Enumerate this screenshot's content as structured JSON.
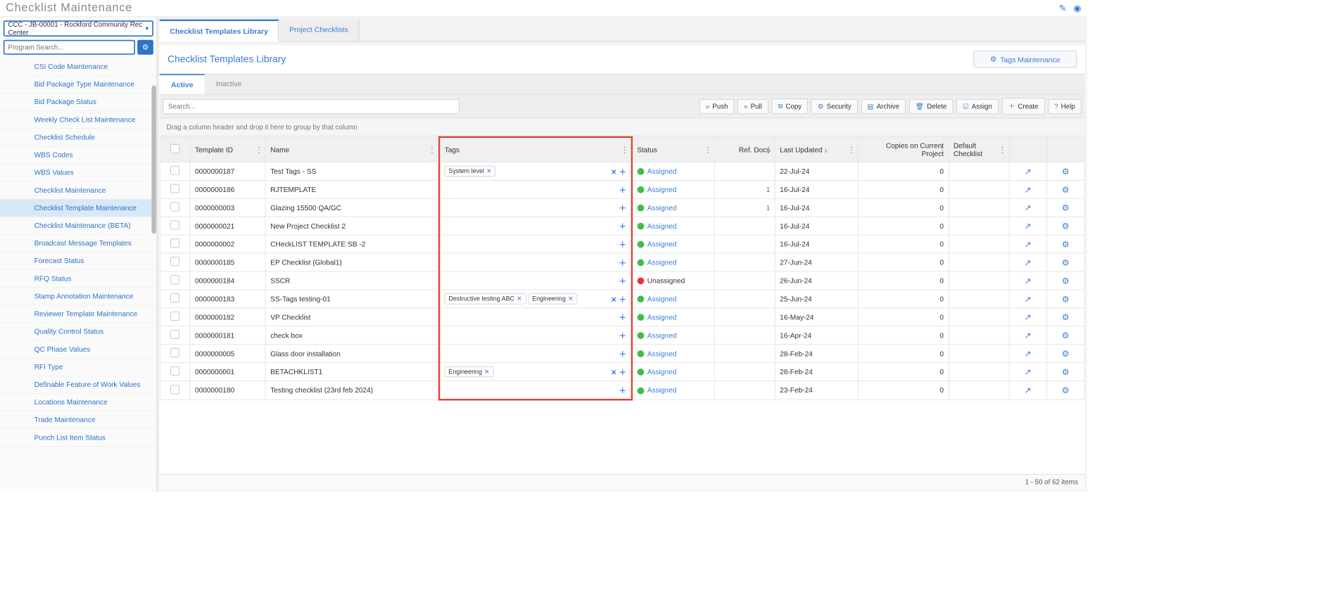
{
  "header": {
    "title": "Checklist Maintenance"
  },
  "sidebar": {
    "project": "CCC - JB-00001 - Rockford Community Rec Center",
    "search_placeholder": "Program Search...",
    "items": [
      {
        "label": "CSI Code Maintenance"
      },
      {
        "label": "Bid Package Type Maintenance"
      },
      {
        "label": "Bid Package Status"
      },
      {
        "label": "Weekly Check List Maintenance"
      },
      {
        "label": "Checklist Schedule"
      },
      {
        "label": "WBS Codes"
      },
      {
        "label": "WBS Values"
      },
      {
        "label": "Checklist Maintenance"
      },
      {
        "label": "Checklist Template Maintenance"
      },
      {
        "label": "Checklist Maintenance (BETA)"
      },
      {
        "label": "Broadcast Message Templates"
      },
      {
        "label": "Forecast Status"
      },
      {
        "label": "RFQ Status"
      },
      {
        "label": "Stamp Annotation Maintenance"
      },
      {
        "label": "Reviewer Template Maintenance"
      },
      {
        "label": "Quality Control Status"
      },
      {
        "label": "QC Phase Values"
      },
      {
        "label": "RFI Type"
      },
      {
        "label": "Definable Feature of Work Values"
      },
      {
        "label": "Locations Maintenance"
      },
      {
        "label": "Trade Maintenance"
      },
      {
        "label": "Punch List Item Status"
      }
    ],
    "active_index": 8
  },
  "main": {
    "tabs": [
      {
        "label": "Checklist Templates Library",
        "active": true
      },
      {
        "label": "Project Checklists",
        "active": false
      }
    ],
    "panel_title": "Checklist Templates Library",
    "tags_maintenance_label": "Tags Maintenance",
    "subtabs": [
      {
        "label": "Active",
        "active": true
      },
      {
        "label": "Inactive",
        "active": false
      }
    ],
    "search_placeholder": "Search...",
    "toolbar_buttons": {
      "push": "Push",
      "pull": "Pull",
      "copy": "Copy",
      "security": "Security",
      "archive": "Archive",
      "delete": "Delete",
      "assign": "Assign",
      "create": "Create",
      "help": "Help"
    },
    "group_hint": "Drag a column header and drop it here to group by that column",
    "columns": {
      "template_id": "Template ID",
      "name": "Name",
      "tags": "Tags",
      "status": "Status",
      "ref_docs": "Ref. Docs",
      "last_updated": "Last Updated",
      "copies": "Copies on Current Project",
      "default": "Default Checklist"
    },
    "rows": [
      {
        "id": "0000000187",
        "name": "Test Tags - SS",
        "tags": [
          "System level"
        ],
        "has_remove": true,
        "status": "Assigned",
        "status_color": "green",
        "ref": "",
        "updated": "22-Jul-24",
        "copies": "0",
        "default": ""
      },
      {
        "id": "0000000186",
        "name": "RJTEMPLATE",
        "tags": [],
        "has_remove": false,
        "status": "Assigned",
        "status_color": "green",
        "ref": "1",
        "updated": "16-Jul-24",
        "copies": "0",
        "default": ""
      },
      {
        "id": "0000000003",
        "name": "Glazing 15500 QA/GC",
        "tags": [],
        "has_remove": false,
        "status": "Assigned",
        "status_color": "green",
        "ref": "1",
        "updated": "16-Jul-24",
        "copies": "0",
        "default": ""
      },
      {
        "id": "0000000021",
        "name": "New Project Checklist 2",
        "tags": [],
        "has_remove": false,
        "status": "Assigned",
        "status_color": "green",
        "ref": "",
        "updated": "16-Jul-24",
        "copies": "0",
        "default": ""
      },
      {
        "id": "0000000002",
        "name": "CHeckLIST TEMPLATE SB -2",
        "tags": [],
        "has_remove": false,
        "status": "Assigned",
        "status_color": "green",
        "ref": "",
        "updated": "16-Jul-24",
        "copies": "0",
        "default": ""
      },
      {
        "id": "0000000185",
        "name": "EP Checklist (Global1)",
        "tags": [],
        "has_remove": false,
        "status": "Assigned",
        "status_color": "green",
        "ref": "",
        "updated": "27-Jun-24",
        "copies": "0",
        "default": ""
      },
      {
        "id": "0000000184",
        "name": "SSCR",
        "tags": [],
        "has_remove": false,
        "status": "Unassigned",
        "status_color": "red",
        "ref": "",
        "updated": "26-Jun-24",
        "copies": "0",
        "default": ""
      },
      {
        "id": "0000000183",
        "name": "SS-Tags testing-01",
        "tags": [
          "Destructive testing ABC",
          "Engineering"
        ],
        "has_remove": true,
        "status": "Assigned",
        "status_color": "green",
        "ref": "",
        "updated": "25-Jun-24",
        "copies": "0",
        "default": ""
      },
      {
        "id": "0000000182",
        "name": "VP Checklist",
        "tags": [],
        "has_remove": false,
        "status": "Assigned",
        "status_color": "green",
        "ref": "",
        "updated": "16-May-24",
        "copies": "0",
        "default": ""
      },
      {
        "id": "0000000181",
        "name": "check box",
        "tags": [],
        "has_remove": false,
        "status": "Assigned",
        "status_color": "green",
        "ref": "",
        "updated": "16-Apr-24",
        "copies": "0",
        "default": ""
      },
      {
        "id": "0000000005",
        "name": "Glass door installation",
        "tags": [],
        "has_remove": false,
        "status": "Assigned",
        "status_color": "green",
        "ref": "",
        "updated": "28-Feb-24",
        "copies": "0",
        "default": ""
      },
      {
        "id": "0000000001",
        "name": "BETACHKLIST1",
        "tags": [
          "Engineering"
        ],
        "has_remove": true,
        "status": "Assigned",
        "status_color": "green",
        "ref": "",
        "updated": "28-Feb-24",
        "copies": "0",
        "default": ""
      },
      {
        "id": "0000000180",
        "name": "Testing checklist (23rd feb 2024)",
        "tags": [],
        "has_remove": false,
        "status": "Assigned",
        "status_color": "green",
        "ref": "",
        "updated": "23-Feb-24",
        "copies": "0",
        "default": ""
      }
    ],
    "footer": "1 - 50 of 62 items"
  }
}
